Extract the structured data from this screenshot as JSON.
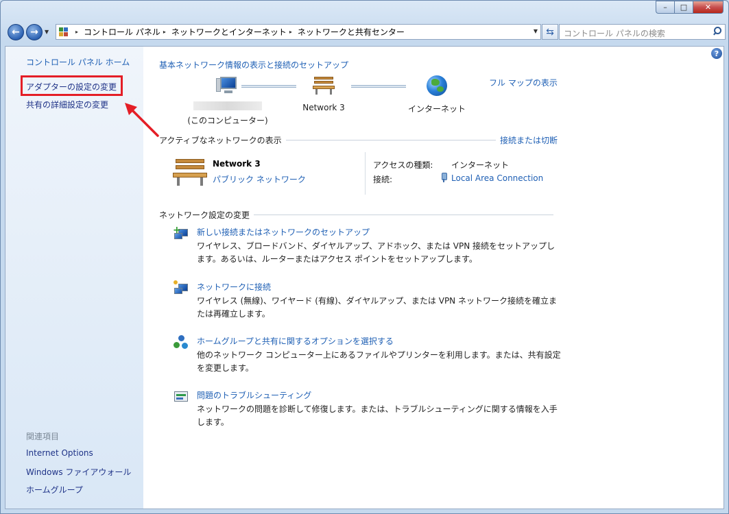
{
  "window": {
    "minimize": "–",
    "maximize": "□",
    "close": "✕"
  },
  "nav": {
    "back_icon": "←",
    "forward_icon": "→",
    "history_dropdown": "▼",
    "breadcrumb": [
      "コントロール パネル",
      "ネットワークとインターネット",
      "ネットワークと共有センター"
    ],
    "breadcrumb_sep": "▸",
    "address_dropdown": "▼",
    "refresh_icon": "⇆",
    "search_placeholder": "コントロール パネルの検索"
  },
  "sidebar": {
    "home": "コントロール パネル ホーム",
    "adapter_settings": "アダプターの設定の変更",
    "sharing_settings": "共有の詳細設定の変更",
    "related_heading": "関連項目",
    "related": [
      "Internet Options",
      "Windows ファイアウォール",
      "ホームグループ"
    ]
  },
  "help_icon": "?",
  "main": {
    "heading": "基本ネットワーク情報の表示と接続のセットアップ",
    "full_map": "フル マップの表示",
    "map": {
      "computer_label": "(このコンピューター)",
      "network_label": "Network  3",
      "internet_label": "インターネット"
    },
    "active_title": "アクティブなネットワークの表示",
    "connect_disconnect": "接続または切断",
    "active_network": {
      "name": "Network  3",
      "type": "パブリック ネットワーク",
      "access_label": "アクセスの種類:",
      "access_value": "インターネット",
      "connection_label": "接続:",
      "connection_value": "Local Area Connection"
    },
    "change_title": "ネットワーク設定の変更",
    "tasks": [
      {
        "link": "新しい接続またはネットワークのセットアップ",
        "desc": "ワイヤレス、ブロードバンド、ダイヤルアップ、アドホック、または VPN 接続をセットアップします。あるいは、ルーターまたはアクセス ポイントをセットアップします。"
      },
      {
        "link": "ネットワークに接続",
        "desc": "ワイヤレス (無線)、ワイヤード (有線)、ダイヤルアップ、または VPN ネットワーク接続を確立または再確立します。"
      },
      {
        "link": "ホームグループと共有に関するオプションを選択する",
        "desc": "他のネットワーク コンピューター上にあるファイルやプリンターを利用します。または、共有設定を変更します。"
      },
      {
        "link": "問題のトラブルシューティング",
        "desc": "ネットワークの問題を診断して修復します。または、トラブルシューティングに関する情報を入手します。"
      }
    ]
  },
  "colors": {
    "link": "#1e5fb4",
    "highlight": "#e41e26"
  }
}
